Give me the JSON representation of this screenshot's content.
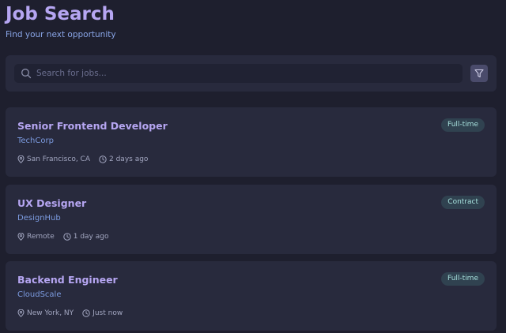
{
  "header": {
    "title": "Job Search",
    "subtitle": "Find your next opportunity"
  },
  "search": {
    "placeholder": "Search for jobs...",
    "value": "",
    "icon": "search-icon",
    "filter_icon": "filter-icon"
  },
  "jobs": [
    {
      "title": "Senior Frontend Developer",
      "company": "TechCorp",
      "location": "San Francisco, CA",
      "posted": "2 days ago",
      "type": "Full-time"
    },
    {
      "title": "UX Designer",
      "company": "DesignHub",
      "location": "Remote",
      "posted": "1 day ago",
      "type": "Contract"
    },
    {
      "title": "Backend Engineer",
      "company": "CloudScale",
      "location": "New York, NY",
      "posted": "Just now",
      "type": "Full-time"
    }
  ],
  "colors": {
    "background": "#1e1f2e",
    "card": "#282a3d",
    "accent": "#b6a6f2",
    "company": "#7c9be0",
    "badge_bg": "#304250",
    "badge_text": "#a6e0dc"
  }
}
